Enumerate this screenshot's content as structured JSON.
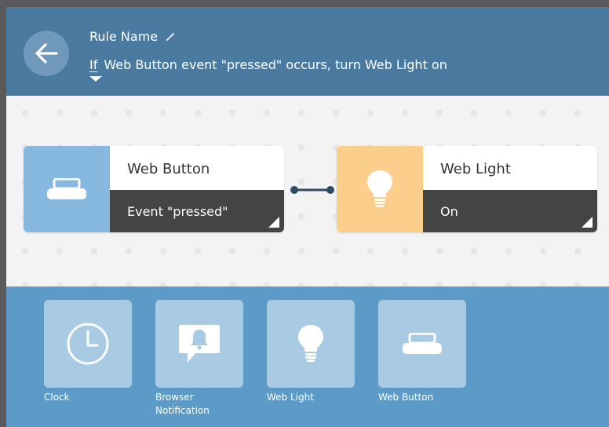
{
  "header": {
    "rule_name": "Rule Name",
    "if_word": "If",
    "rule_description": "Web Button event \"pressed\" occurs, turn Web Light on"
  },
  "canvas": {
    "trigger": {
      "title": "Web Button",
      "detail": "Event \"pressed\"",
      "icon": "web-button-icon",
      "color": "#86b8e0"
    },
    "action": {
      "title": "Web Light",
      "detail": "On",
      "icon": "lightbulb-icon",
      "color": "#fcce8c"
    }
  },
  "palette": {
    "items": [
      {
        "label": "Clock",
        "icon": "clock-icon"
      },
      {
        "label": "Browser Notification",
        "icon": "browser-notification-icon"
      },
      {
        "label": "Web Light",
        "icon": "lightbulb-icon"
      },
      {
        "label": "Web Button",
        "icon": "web-button-icon"
      }
    ]
  },
  "colors": {
    "header_bg": "#4a7aa0",
    "canvas_bg": "#f3f3f3",
    "palette_bg": "#5c9bc8",
    "block_detail_bg": "#444444"
  }
}
